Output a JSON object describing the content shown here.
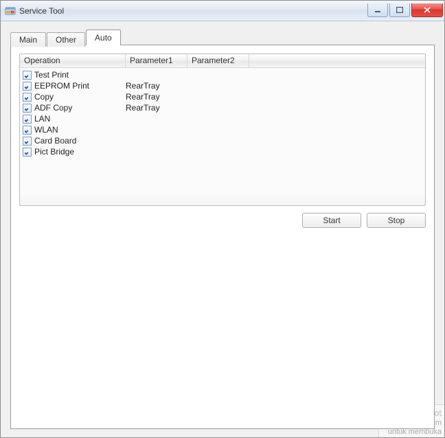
{
  "window": {
    "title": "Service Tool"
  },
  "tabs": [
    {
      "label": "Main",
      "active": false
    },
    {
      "label": "Other",
      "active": false
    },
    {
      "label": "Auto",
      "active": true
    }
  ],
  "listview": {
    "columns": [
      "Operation",
      "Parameter1",
      "Parameter2"
    ],
    "rows": [
      {
        "checked": true,
        "operation": "Test Print",
        "param1": "",
        "param2": ""
      },
      {
        "checked": true,
        "operation": "EEPROM Print",
        "param1": "RearTray",
        "param2": ""
      },
      {
        "checked": true,
        "operation": "Copy",
        "param1": "RearTray",
        "param2": ""
      },
      {
        "checked": true,
        "operation": "ADF Copy",
        "param1": "RearTray",
        "param2": ""
      },
      {
        "checked": true,
        "operation": "LAN",
        "param1": "",
        "param2": ""
      },
      {
        "checked": true,
        "operation": "WLAN",
        "param1": "",
        "param2": ""
      },
      {
        "checked": true,
        "operation": "Card Board",
        "param1": "",
        "param2": ""
      },
      {
        "checked": true,
        "operation": "Pict Bridge",
        "param1": "",
        "param2": ""
      }
    ]
  },
  "buttons": {
    "start": "Start",
    "stop": "Stop"
  },
  "lightshot": {
    "title": "Lightshot",
    "line1": "Screenshot disim",
    "line2": "untuk membuka"
  }
}
